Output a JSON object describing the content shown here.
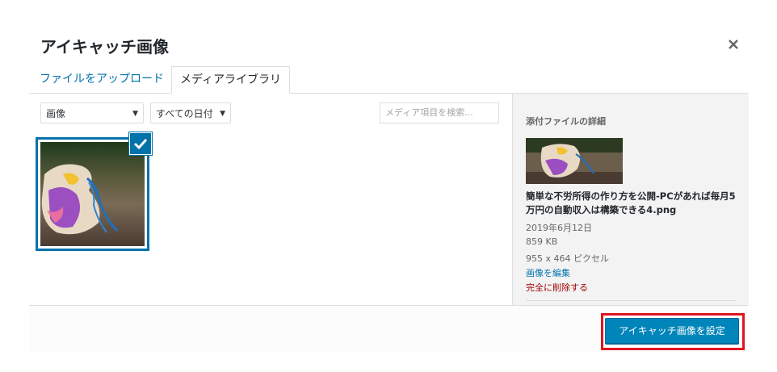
{
  "modal": {
    "title": "アイキャッチ画像",
    "close_icon": "close-icon"
  },
  "tabs": [
    {
      "label": "ファイルをアップロード",
      "active": false
    },
    {
      "label": "メディアライブラリ",
      "active": true
    }
  ],
  "filters": {
    "type_value": "画像",
    "date_value": "すべての日付",
    "search_placeholder": "メディア項目を検索..."
  },
  "sidebar": {
    "heading": "添付ファイルの詳細",
    "filename": "簡単な不労所得の作り方を公開-PCがあれば毎月5万円の自動収入は構築できる4.png",
    "date": "2019年6月12日",
    "filesize": "859 KB",
    "dimensions": "955 x 464 ピクセル",
    "edit_link": "画像を編集",
    "delete_link": "完全に削除する"
  },
  "toolbar": {
    "set_button": "アイキャッチ画像を設定"
  },
  "colors": {
    "accent": "#0073aa",
    "button": "#0085ba",
    "highlight": "#e0141e",
    "delete": "#a00000"
  }
}
